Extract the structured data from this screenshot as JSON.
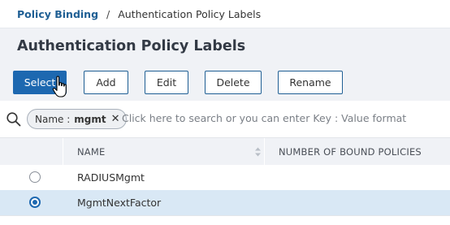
{
  "breadcrumb": {
    "parent": "Policy Binding",
    "separator": "/",
    "current": "Authentication Policy Labels"
  },
  "page": {
    "title": "Authentication Policy Labels"
  },
  "toolbar": {
    "select": "Select",
    "add": "Add",
    "edit": "Edit",
    "delete": "Delete",
    "rename": "Rename"
  },
  "search": {
    "chip_key": "Name :",
    "chip_value": "mgmt",
    "chip_close": "✕",
    "placeholder": "Click here to search or you can enter Key : Value format"
  },
  "table": {
    "headers": [
      "NAME",
      "NUMBER OF BOUND POLICIES"
    ],
    "rows": [
      {
        "name": "RADIUSMgmt",
        "selected": false
      },
      {
        "name": "MgmtNextFactor",
        "selected": true
      }
    ]
  },
  "icons": {
    "search": "search-icon",
    "cursor": "hand-pointer-icon",
    "sort": "sort-icon"
  },
  "colors": {
    "primary": "#1d68b0",
    "link": "#1f5f94",
    "selected_row": "#d9e8f5",
    "header_bg": "#f0f2f6"
  }
}
